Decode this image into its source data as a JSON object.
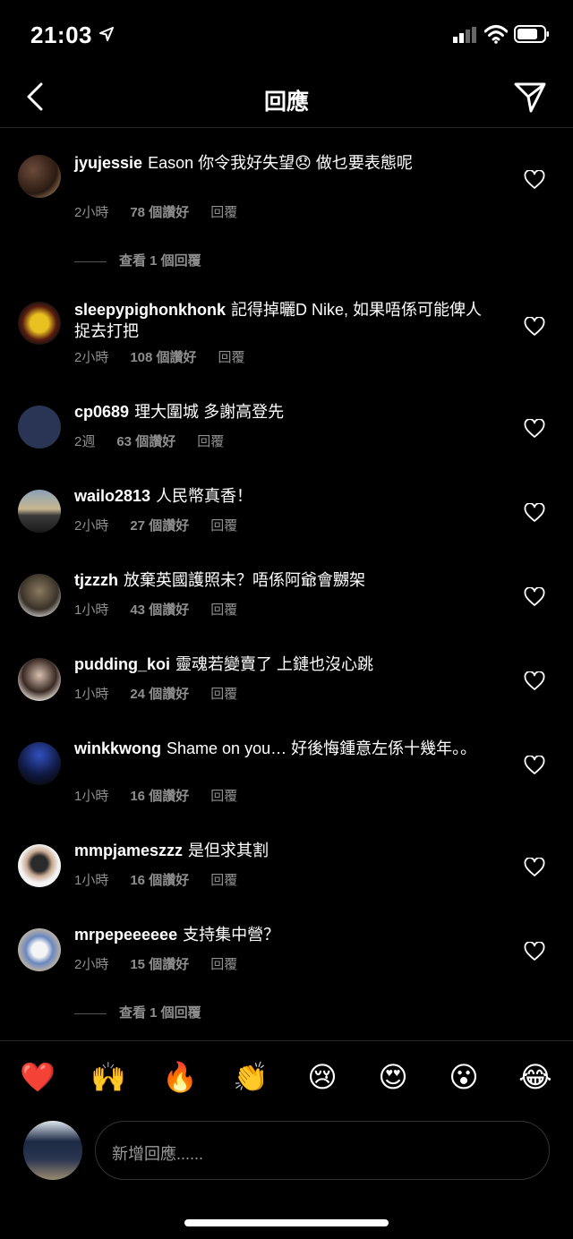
{
  "status": {
    "time": "21:03"
  },
  "header": {
    "title": "回應"
  },
  "comments": [
    {
      "username": "jyujessie",
      "text": "Eason 你令我好失望😞 做乜要表態呢",
      "time": "2小時",
      "likes": "78 個讚好",
      "reply": "回覆",
      "view_replies": "查看 1 個回覆"
    },
    {
      "username": "sleepypighonkhonk",
      "text": "記得掉曬D Nike, 如果唔係可能俾人捉去打把",
      "time": "2小時",
      "likes": "108 個讚好",
      "reply": "回覆"
    },
    {
      "username": "cp0689",
      "text": "理大圍城 多謝高登先",
      "time": "2週",
      "likes": "63 個讚好",
      "reply": "回覆"
    },
    {
      "username": "wailo2813",
      "text": "人民幣真香！",
      "time": "2小時",
      "likes": "27 個讚好",
      "reply": "回覆"
    },
    {
      "username": "tjzzzh",
      "text": "放棄英國護照未？唔係阿爺會嬲架",
      "time": "1小時",
      "likes": "43 個讚好",
      "reply": "回覆"
    },
    {
      "username": "pudding_koi",
      "text": "靈魂若變賣了 上鏈也沒心跳",
      "time": "1小時",
      "likes": "24 個讚好",
      "reply": "回覆"
    },
    {
      "username": "winkkwong",
      "text": "Shame on you… 好後悔鍾意左係十幾年。。",
      "time": "1小時",
      "likes": "16 個讚好",
      "reply": "回覆"
    },
    {
      "username": "mmpjameszzz",
      "text": "是但求其割",
      "time": "1小時",
      "likes": "16 個讚好",
      "reply": "回覆"
    },
    {
      "username": "mrpepeeeeee",
      "text": "支持集中營？",
      "time": "2小時",
      "likes": "15 個讚好",
      "reply": "回覆",
      "view_replies": "查看 1 個回覆"
    }
  ],
  "emoji_bar": [
    "❤️",
    "🙌",
    "🔥",
    "👏",
    "😢",
    "😍",
    "😮",
    "😂"
  ],
  "composer": {
    "placeholder": "新增回應......"
  },
  "colors": {
    "background": "#000000",
    "text": "#ffffff",
    "secondary": "#8e8e8e",
    "divider": "#262626"
  },
  "icons": [
    "location-arrow-icon",
    "signal-icon",
    "wifi-icon",
    "battery-icon",
    "back-chevron-icon",
    "direct-send-icon",
    "heart-outline-icon"
  ]
}
